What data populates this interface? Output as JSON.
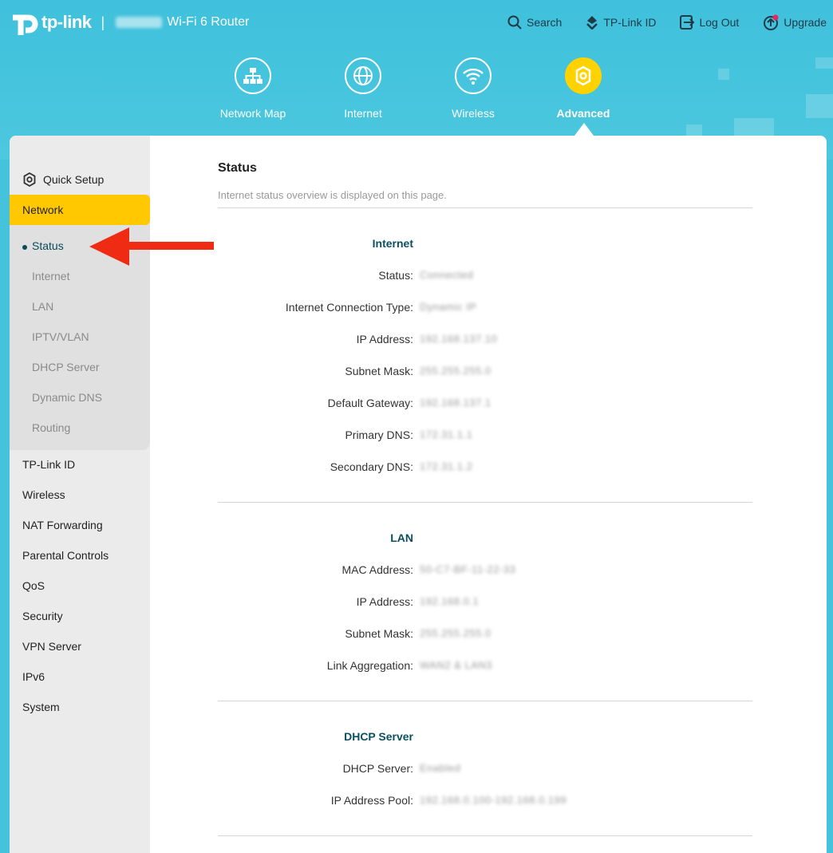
{
  "header": {
    "brand": "tp-link",
    "separator": "|",
    "router_name": "Wi-Fi 6 Router",
    "nav": [
      {
        "label": "Search",
        "icon": "search-icon"
      },
      {
        "label": "TP-Link ID",
        "icon": "tplink-id-icon"
      },
      {
        "label": "Log Out",
        "icon": "logout-icon"
      },
      {
        "label": "Upgrade",
        "icon": "upgrade-icon"
      }
    ],
    "tabs": [
      {
        "label": "Network Map",
        "icon": "network-map-icon"
      },
      {
        "label": "Internet",
        "icon": "globe-icon"
      },
      {
        "label": "Wireless",
        "icon": "wifi-icon"
      },
      {
        "label": "Advanced",
        "icon": "gear-icon",
        "active": true
      }
    ]
  },
  "sidebar": {
    "quick_setup": "Quick Setup",
    "network": "Network",
    "network_sub": [
      "Status",
      "Internet",
      "LAN",
      "IPTV/VLAN",
      "DHCP Server",
      "Dynamic DNS",
      "Routing"
    ],
    "items": [
      "TP-Link ID",
      "Wireless",
      "NAT Forwarding",
      "Parental Controls",
      "QoS",
      "Security",
      "VPN Server",
      "IPv6",
      "System"
    ]
  },
  "main": {
    "title": "Status",
    "description": "Internet status overview is displayed on this page.",
    "internet": {
      "title": "Internet",
      "rows": [
        {
          "label": "Status:",
          "value": "Connected"
        },
        {
          "label": "Internet Connection Type:",
          "value": "Dynamic IP"
        },
        {
          "label": "IP Address:",
          "value": "192.168.137.10"
        },
        {
          "label": "Subnet Mask:",
          "value": "255.255.255.0"
        },
        {
          "label": "Default Gateway:",
          "value": "192.168.137.1"
        },
        {
          "label": "Primary DNS:",
          "value": "172.31.1.1"
        },
        {
          "label": "Secondary DNS:",
          "value": "172.31.1.2"
        }
      ]
    },
    "lan": {
      "title": "LAN",
      "rows": [
        {
          "label": "MAC Address:",
          "value": "50-C7-BF-11-22-33"
        },
        {
          "label": "IP Address:",
          "value": "192.168.0.1"
        },
        {
          "label": "Subnet Mask:",
          "value": "255.255.255.0"
        },
        {
          "label": "Link Aggregation:",
          "value": "WAN2 & LAN3"
        }
      ]
    },
    "dhcp": {
      "title": "DHCP Server",
      "rows": [
        {
          "label": "DHCP Server:",
          "value": "Enabled"
        },
        {
          "label": "IP Address Pool:",
          "value": "192.168.0.100-192.168.0.199"
        }
      ]
    }
  },
  "colors": {
    "header_bg": "#46c3dc",
    "accent": "#ffc800",
    "section_title": "#0a5060",
    "annotation_arrow": "#f02b13"
  }
}
